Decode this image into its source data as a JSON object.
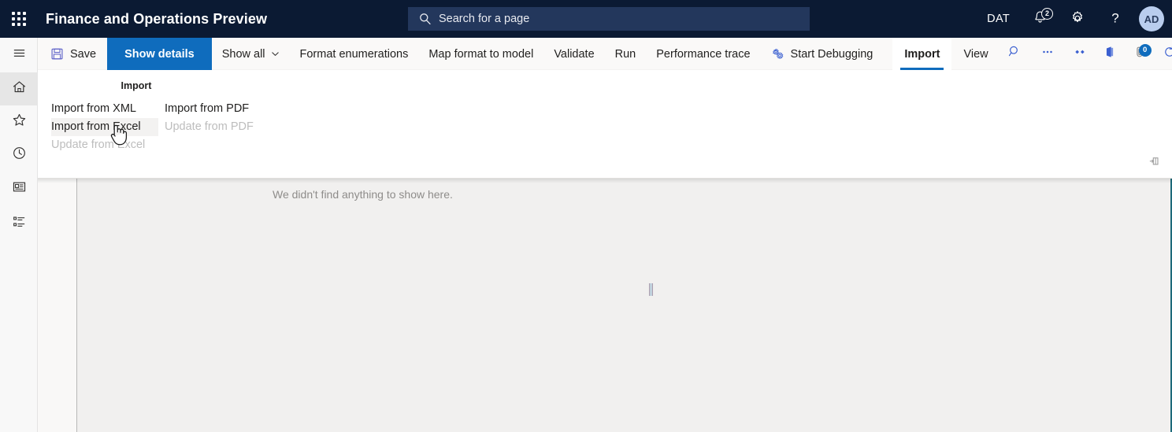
{
  "topbar": {
    "waffle_label": "app-launcher",
    "title": "Finance and Operations Preview",
    "search": {
      "placeholder": "Search for a page",
      "value": "",
      "icon": "search-icon"
    },
    "company": "DAT",
    "notifications": {
      "icon": "bell-icon",
      "count": "2"
    },
    "settings": {
      "icon": "gear-icon"
    },
    "help": {
      "icon": "question-mark-icon"
    },
    "avatar": {
      "initials": "AD"
    }
  },
  "rail": {
    "items": [
      {
        "name": "hamburger-menu",
        "icon": "hamburger-icon",
        "active": false
      },
      {
        "name": "home",
        "icon": "home-icon",
        "active": true
      },
      {
        "name": "favorites",
        "icon": "star-icon",
        "active": false
      },
      {
        "name": "recent",
        "icon": "clock-icon",
        "active": false
      },
      {
        "name": "workspaces",
        "icon": "workspace-icon",
        "active": false
      },
      {
        "name": "modules",
        "icon": "list-icon",
        "active": false
      }
    ]
  },
  "ribbon": {
    "save_label": "Save",
    "save_icon": "save-disk-icon",
    "show_details_label": "Show details",
    "show_all_label": "Show all",
    "show_all_caret": "chevron-down-icon",
    "format_enumerations_label": "Format enumerations",
    "map_format_label": "Map format to model",
    "validate_label": "Validate",
    "run_label": "Run",
    "performance_trace_label": "Performance trace",
    "start_debugging_label": "Start Debugging",
    "start_debugging_icon": "gears-icon",
    "tabs": [
      {
        "label": "Import",
        "active": true
      },
      {
        "label": "View",
        "active": false
      }
    ],
    "right_icons": [
      {
        "name": "ribbon-search",
        "icon": "search-icon",
        "badge": ""
      },
      {
        "name": "ribbon-overflow",
        "icon": "ellipsis-icon",
        "badge": ""
      },
      {
        "name": "ribbon-share",
        "icon": "link-share-icon",
        "badge": ""
      },
      {
        "name": "ribbon-office",
        "icon": "office-app-icon",
        "badge": ""
      },
      {
        "name": "ribbon-attachments",
        "icon": "paperclip-icon",
        "badge": "0"
      },
      {
        "name": "ribbon-refresh",
        "icon": "refresh-icon",
        "badge": ""
      },
      {
        "name": "ribbon-popout",
        "icon": "open-in-new-window-icon",
        "badge": ""
      },
      {
        "name": "ribbon-close",
        "icon": "close-icon",
        "badge": ""
      }
    ]
  },
  "panel": {
    "group_title": "Import",
    "column_1": [
      {
        "label": "Import from XML",
        "state": "normal"
      },
      {
        "label": "Import from Excel",
        "state": "hover"
      },
      {
        "label": "Update from Excel",
        "state": "disabled"
      }
    ],
    "column_2": [
      {
        "label": "Import from PDF",
        "state": "normal"
      },
      {
        "label": "Update from PDF",
        "state": "disabled"
      }
    ],
    "pin_icon": "pin-ribbon-icon"
  },
  "workspace": {
    "empty_message": "We didn't find anything to show here.",
    "splitter_name": "panel-splitter"
  },
  "colors": {
    "nav_background": "#0b1a33",
    "search_background": "#23375c",
    "accent": "#0f6cbd",
    "ribbon_background": "#faf9f8",
    "workspace_background": "#f1f0ef",
    "hover_background": "#f3f2f1",
    "disabled_text": "#bdbdbd",
    "right_border": "#1d6a7a"
  }
}
